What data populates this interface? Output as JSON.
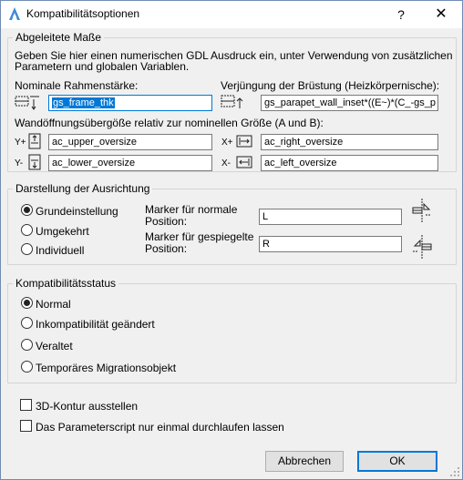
{
  "window": {
    "title": "Kompatibilitätsoptionen",
    "help": "?",
    "close": "✕"
  },
  "derived": {
    "title": "Abgeleitete Maße",
    "description_line1": "Geben Sie hier einen numerischen GDL Ausdruck ein, unter Verwendung von zusätzlichen",
    "description_line2": "Parametern und globalen Variablen.",
    "frame_label": "Nominale Rahmenstärke:",
    "frame_value": "gs_frame_thk",
    "parapet_label": "Verjüngung der Brüstung (Heizkörpernische):",
    "parapet_value": "gs_parapet_wall_inset*((E~)*(C_-gs_p",
    "oversize_label": "Wandöffnungsübergöße relativ zur nominellen Größe (A und B):",
    "upper_prefix": "Y+",
    "upper_value": "ac_upper_oversize",
    "right_prefix": "X+",
    "right_value": "ac_right_oversize",
    "lower_prefix": "Y-",
    "lower_value": "ac_lower_oversize",
    "left_prefix": "X-",
    "left_value": "ac_left_oversize"
  },
  "orientation": {
    "title": "Darstellung der Ausrichtung",
    "options": [
      "Grundeinstellung",
      "Umgekehrt",
      "Individuell"
    ],
    "selected": 0,
    "marker_normal_label1": "Marker für normale",
    "marker_normal_label2": "Position:",
    "marker_normal_value": "L",
    "marker_mirror_label1": "Marker für gespiegelte",
    "marker_mirror_label2": "Position:",
    "marker_mirror_value": "R"
  },
  "compat": {
    "title": "Kompatibilitätsstatus",
    "options": [
      "Normal",
      "Inkompatibilität geändert",
      "Veraltet",
      "Temporäres Migrationsobjekt"
    ],
    "selected": 0
  },
  "checkboxes": {
    "contour": "3D-Kontur ausstellen",
    "script_once": "Das Parameterscript nur einmal durchlaufen lassen"
  },
  "buttons": {
    "cancel": "Abbrechen",
    "ok": "OK"
  }
}
